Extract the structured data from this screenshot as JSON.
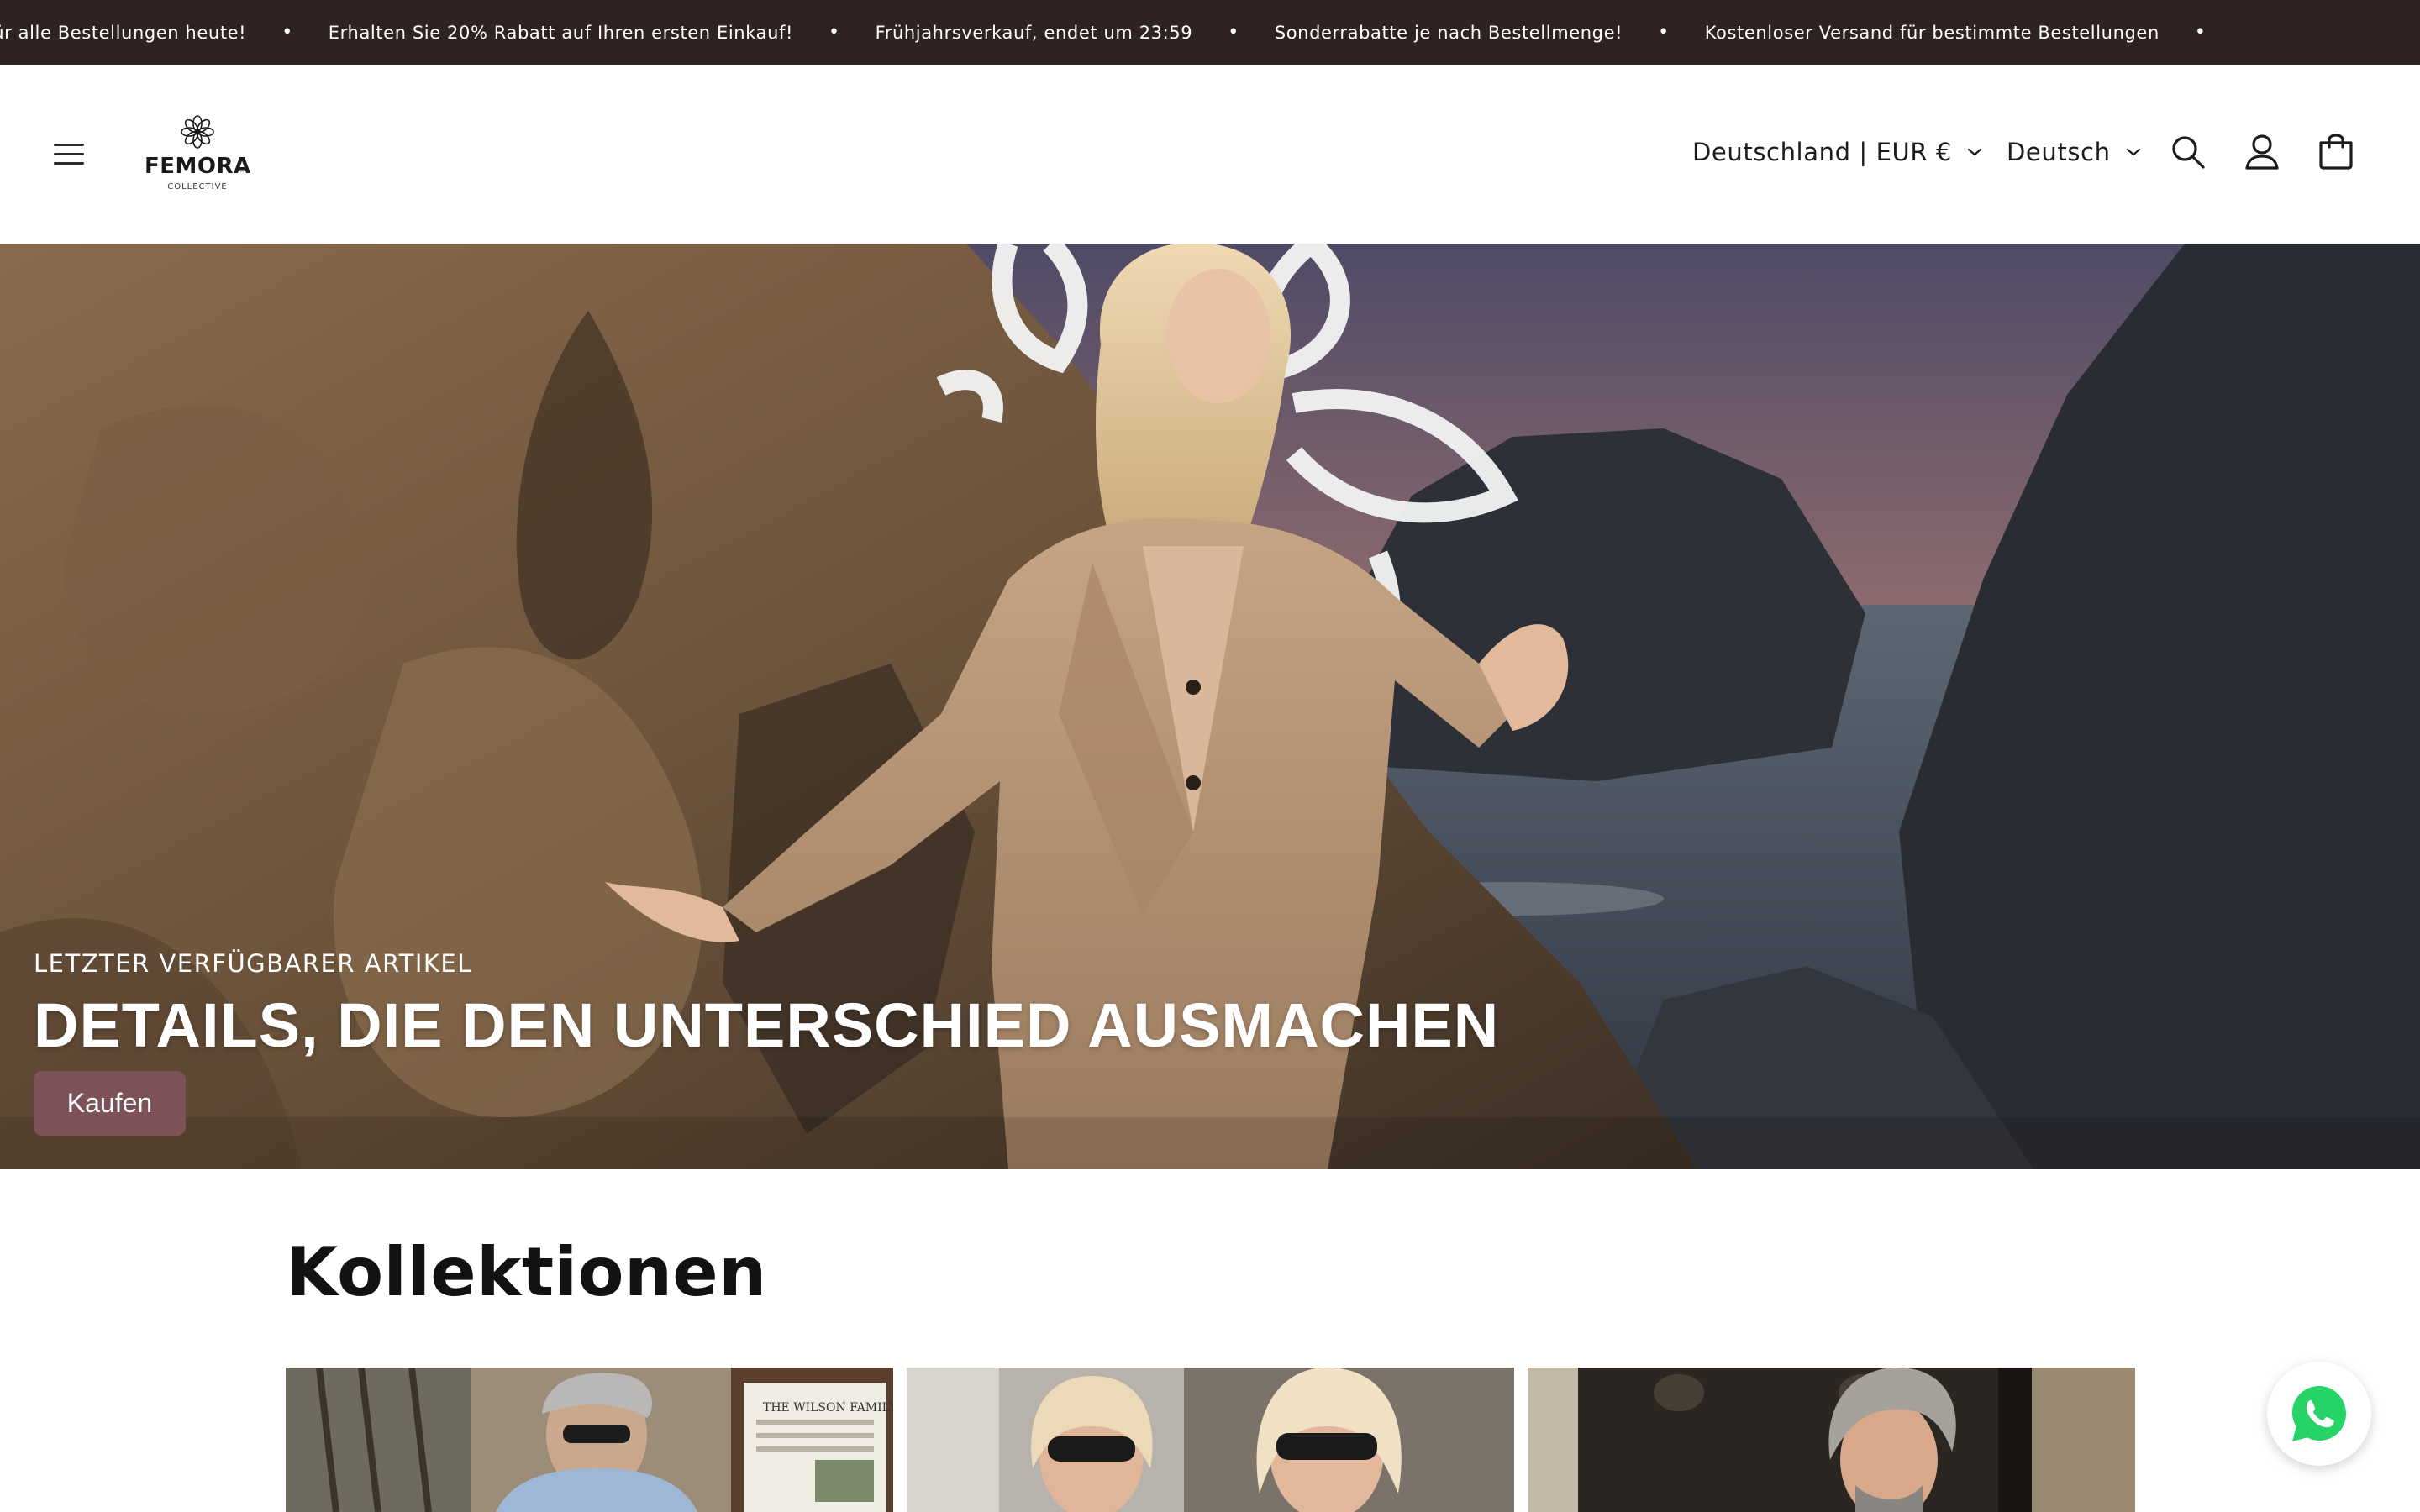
{
  "announcement": {
    "items": [
      "d für alle Bestellungen heute!",
      "Erhalten Sie 20% Rabatt auf Ihren ersten Einkauf!",
      "Frühjahrsverkauf, endet um 23:59",
      "Sonderrabatte je nach Bestellmenge!",
      "Kostenloser Versand für bestimmte Bestellungen"
    ],
    "separator": "•"
  },
  "header": {
    "logo": {
      "name": "FEMORA",
      "sub": "COLLECTIVE"
    },
    "country_selector": "Deutschland | EUR €",
    "language_selector": "Deutsch",
    "icons": [
      "menu-icon",
      "search-icon",
      "account-icon",
      "cart-icon",
      "chevron-down-icon"
    ]
  },
  "hero": {
    "subheading": "LETZTER VERFÜGBARER ARTIKEL",
    "heading": "DETAILS, DIE DEN UNTERSCHIED AUSMACHEN",
    "button_label": "Kaufen"
  },
  "collections": {
    "title": "Kollektionen",
    "sign_text": "THE WILSON FAMILY"
  },
  "floating": {
    "icon": "whatsapp-icon"
  },
  "colors": {
    "announcement_bg": "#2e2222",
    "cta_bg": "#7d5257",
    "whatsapp_green": "#25d366"
  }
}
